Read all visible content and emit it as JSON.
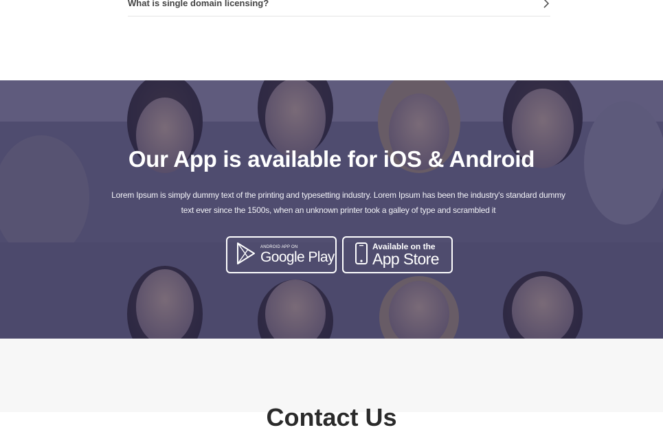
{
  "faq": {
    "question": "What is single domain licensing?",
    "chevron_icon": "chevron-right-icon"
  },
  "app_banner": {
    "title": "Our App is available for iOS & Android",
    "text": "Lorem Ipsum is simply dummy text of the printing and typesetting industry. Lorem Ipsum has been the industry's standard dummy text ever since the 1500s, when an unknown printer took a galley of type and scrambled it",
    "overlay_color": "#2c2a52",
    "google_play": {
      "small_label": "ANDROID APP ON",
      "big_label": "Google Play",
      "icon": "play-icon"
    },
    "app_store": {
      "small_label": "Available on the",
      "big_label": "App Store",
      "icon": "phone-icon"
    }
  },
  "contact": {
    "title": "Contact Us"
  }
}
